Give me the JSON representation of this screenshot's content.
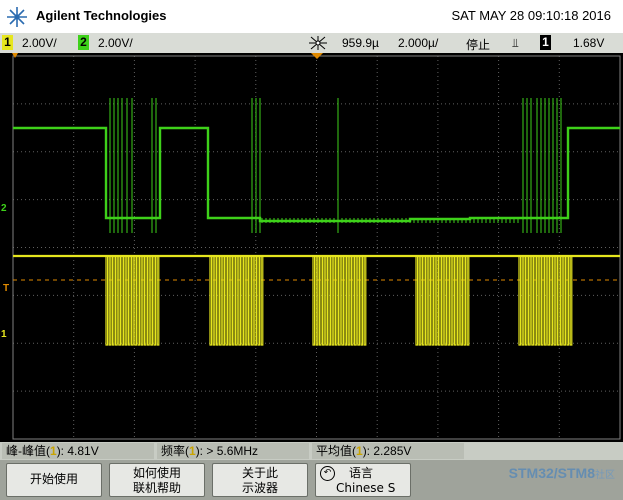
{
  "header": {
    "brand": "Agilent Technologies",
    "datetime": "SAT MAY 28 09:10:18 2016"
  },
  "status_bar": {
    "ch1_number": "1",
    "ch1_scale": "2.00V/",
    "ch2_number": "2",
    "ch2_scale": "2.00V/",
    "timebase_delay": "959.9µ",
    "timebase_scale": "2.000µ/",
    "run_state": "停止",
    "trigger_symbol": "⫫",
    "trigger_channel": "1",
    "trigger_level": "1.68V"
  },
  "channel_markers": {
    "ch2": "2",
    "trigger": "T",
    "ch1": "1"
  },
  "measurements": [
    {
      "label": "峰-峰值(",
      "channel": "1",
      "value": "): 4.81V"
    },
    {
      "label": "频率(",
      "channel": "1",
      "value": "): > 5.6MHz"
    },
    {
      "label": "平均值(",
      "channel": "1",
      "value": "): 2.285V"
    }
  ],
  "softkeys": {
    "getting_started_label": "开始使用",
    "help_line1": "如何使用",
    "help_line2": "联机帮助",
    "about_line1": "关于此",
    "about_line2": "示波器",
    "language_title": "语言",
    "language_value": "Chinese S"
  },
  "watermark": {
    "brand_left": "STM32/STM8",
    "brand_right": "社区"
  },
  "colors": {
    "ch1": "#e6e61e",
    "ch2": "#3ed11a",
    "grid": "#606060",
    "trigger_marker": "#e08a00"
  },
  "icons": {
    "logo": "agilent-spark-icon",
    "acquire": "sun-burst-icon",
    "language": "back-arrow-icon"
  }
}
